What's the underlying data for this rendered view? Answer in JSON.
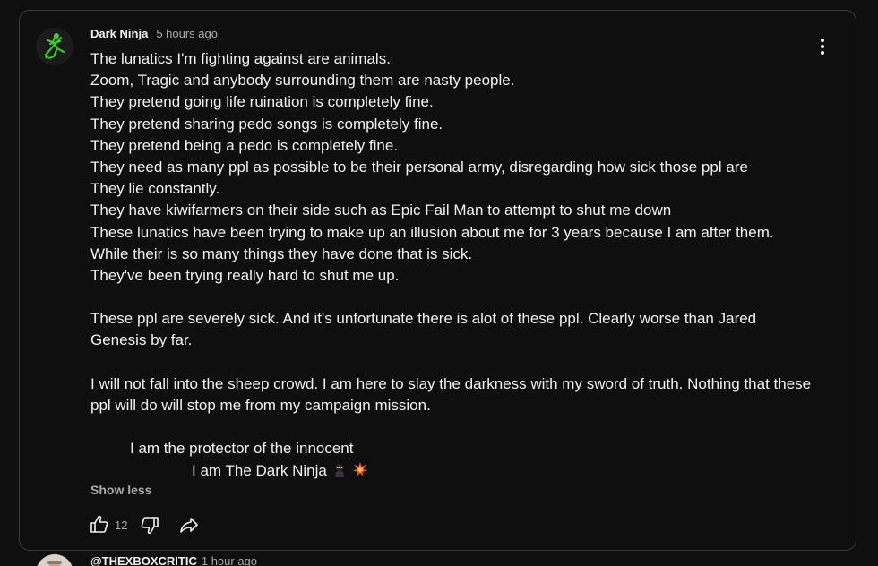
{
  "comment": {
    "author": "Dark Ninja",
    "timestamp": "5 hours ago",
    "lines": [
      "The lunatics I'm fighting against are animals.",
      "Zoom, Tragic and anybody surrounding them are nasty people.",
      "They pretend going life ruination is completely fine.",
      "They pretend sharing pedo songs is completely fine.",
      "They pretend being a pedo is completely fine.",
      "They need as many ppl as possible to be their personal army, disregarding how sick those ppl are",
      "They lie constantly.",
      "They have kiwifarmers on their side such as Epic Fail Man to attempt to shut me down",
      "These lunatics have been trying to make up an illusion about me for 3 years because I am after them.",
      "While their is so many things they have done that is sick.",
      "They've been trying really hard to shut me up."
    ],
    "paragraph2": "These ppl are severely sick. And it's unfortunate there is alot of these ppl. Clearly worse than Jared Genesis by far.",
    "paragraph3": "I will not fall into the sheep crowd. I am here to slay the darkness with my sword of truth. Nothing that these ppl will do will stop me from my campaign mission.",
    "signature_line1": "I am the protector of the innocent",
    "signature_line2": "I am The Dark Ninja",
    "show_less_label": "Show less",
    "like_count": "12"
  },
  "next_comment": {
    "author": "@THEXBOXCRITIC",
    "timestamp": "1 hour ago"
  },
  "icons": {
    "avatar": "ninja-avatar",
    "menu": "vertical-ellipsis-icon",
    "like": "thumbs-up-icon",
    "dislike": "thumbs-down-icon",
    "share": "share-arrow-icon",
    "emoji1": "ninja-emoji",
    "emoji2": "collision-emoji"
  },
  "colors": {
    "background": "#0f0f0f",
    "card_border": "#3a3a3a",
    "text_primary": "#f1f1f1",
    "text_secondary": "#aaaaaa",
    "avatar_accent": "#39d12a"
  }
}
